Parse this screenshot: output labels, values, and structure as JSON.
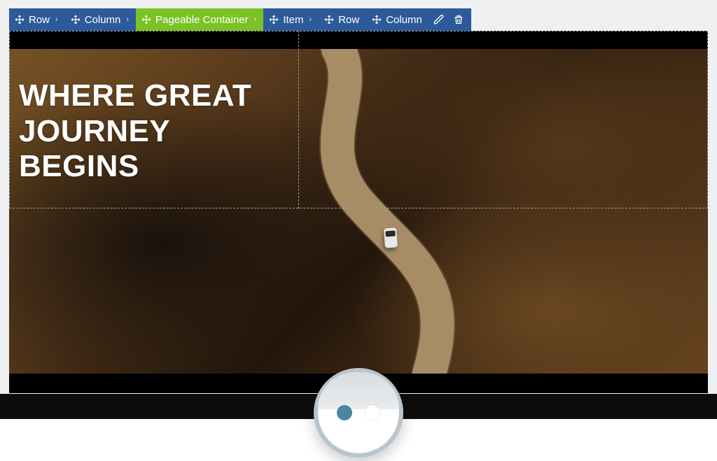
{
  "breadcrumb": {
    "items": [
      {
        "label": "Row"
      },
      {
        "label": "Column"
      },
      {
        "label": "Pageable Container"
      },
      {
        "label": "Item"
      },
      {
        "label": "Row"
      },
      {
        "label": "Column"
      }
    ],
    "active_index": 2
  },
  "hero": {
    "line1": "WHERE GREAT",
    "line2": "JOURNEY",
    "line3": "BEGINS"
  },
  "pager": {
    "count": 2,
    "active": 0
  }
}
